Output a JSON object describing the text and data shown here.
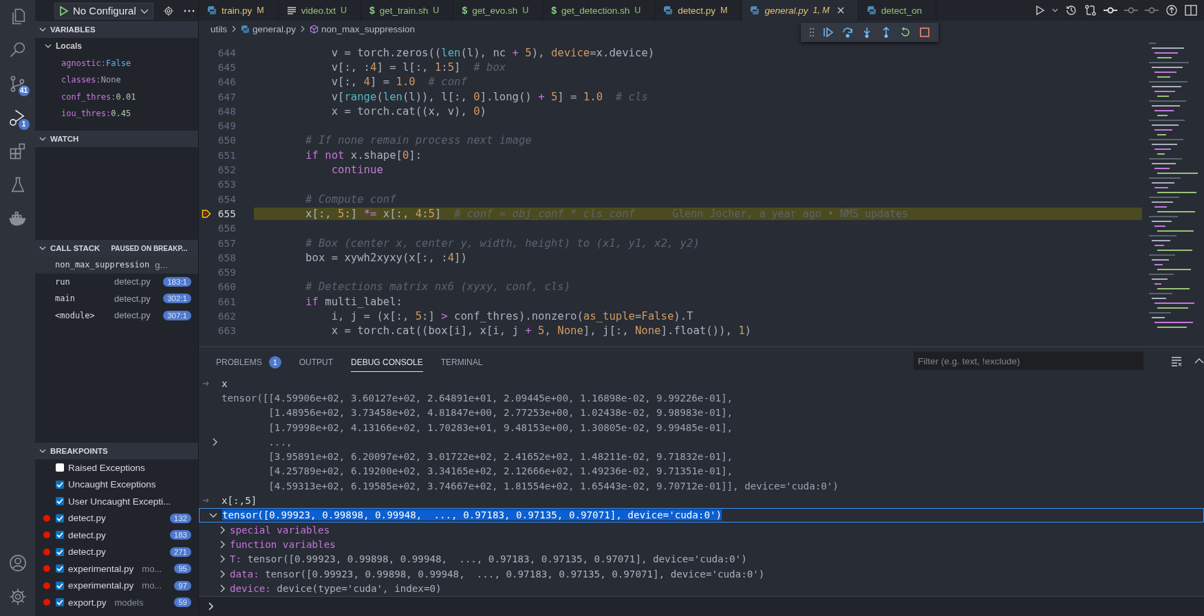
{
  "activity_bar": {
    "items": [
      {
        "kind": "files",
        "selected": false
      },
      {
        "kind": "search",
        "selected": false
      },
      {
        "kind": "scm",
        "selected": false,
        "badge": "41"
      },
      {
        "kind": "debug",
        "selected": true,
        "badge": "1"
      },
      {
        "kind": "extensions",
        "selected": false
      },
      {
        "kind": "testing",
        "selected": false
      },
      {
        "kind": "docker",
        "selected": false
      }
    ],
    "bottom_items": [
      {
        "kind": "account",
        "selected": false
      },
      {
        "kind": "settings",
        "selected": false
      }
    ]
  },
  "debug_bar": {
    "configuration": "No Configural"
  },
  "variables": {
    "title": "VARIABLES",
    "scope": "Locals",
    "items": [
      {
        "name": "agnostic:",
        "value": "False",
        "kind": "bool"
      },
      {
        "name": "classes:",
        "value": "None",
        "kind": "none"
      },
      {
        "name": "conf_thres:",
        "value": "0.01",
        "kind": "number"
      },
      {
        "name": "iou_thres:",
        "value": "0.45",
        "kind": "number"
      }
    ]
  },
  "watch": {
    "title": "WATCH"
  },
  "call_stack": {
    "title": "CALL STACK",
    "status": "PAUSED ON BREAKP...",
    "frames": [
      {
        "name": "non_max_suppression",
        "file": "g...",
        "selected": true
      },
      {
        "name": "run",
        "file": "detect.py",
        "line": "183:1",
        "selected": false
      },
      {
        "name": "main",
        "file": "detect.py",
        "line": "302:1",
        "selected": false
      },
      {
        "name": "<module>",
        "file": "detect.py",
        "line": "307:1",
        "selected": false
      }
    ]
  },
  "breakpoints": {
    "title": "BREAKPOINTS",
    "items": [
      {
        "kind": "exception",
        "label": "Raised Exceptions",
        "checked": false
      },
      {
        "kind": "exception",
        "label": "Uncaught Exceptions",
        "checked": true
      },
      {
        "kind": "exception",
        "label": "User Uncaught Excepti...",
        "checked": true
      },
      {
        "kind": "file",
        "label": "detect.py",
        "checked": true,
        "line": "132"
      },
      {
        "kind": "file",
        "label": "detect.py",
        "checked": true,
        "line": "183"
      },
      {
        "kind": "file",
        "label": "detect.py",
        "checked": true,
        "line": "271"
      },
      {
        "kind": "file",
        "label": "experimental.py",
        "path": "mo...",
        "checked": true,
        "line": "95"
      },
      {
        "kind": "file",
        "label": "experimental.py",
        "path": "mo...",
        "checked": true,
        "line": "97"
      },
      {
        "kind": "file",
        "label": "export.py",
        "path": "models",
        "checked": true,
        "line": "59"
      }
    ]
  },
  "tabs": [
    {
      "kind": "python",
      "label": "train.py",
      "status": "M",
      "color": "#e5c07b",
      "selected": false,
      "preview": false
    },
    {
      "kind": "text",
      "label": "video.txt",
      "status": "U",
      "color": "#98c379",
      "selected": false,
      "preview": false
    },
    {
      "kind": "shell",
      "glyph": "$",
      "label": "get_train.sh",
      "status": "U",
      "color": "#98c379",
      "selected": false,
      "preview": false
    },
    {
      "kind": "shell",
      "glyph": "$",
      "label": "get_evo.sh",
      "status": "U",
      "color": "#98c379",
      "selected": false,
      "preview": false
    },
    {
      "kind": "shell",
      "glyph": "$",
      "label": "get_detection.sh",
      "status": "U",
      "color": "#98c379",
      "selected": false,
      "preview": false
    },
    {
      "kind": "python",
      "label": "detect.py",
      "status": "M",
      "color": "#e5c07b",
      "selected": false,
      "preview": false
    },
    {
      "kind": "python",
      "label": "general.py",
      "status": "1, M",
      "color": "#e5c07b",
      "selected": true,
      "preview": true
    },
    {
      "kind": "python",
      "label": "detect_on",
      "color": "#98c379",
      "selected": false,
      "preview": false
    }
  ],
  "breadcrumbs": [
    {
      "kind": "folder",
      "label": "utils"
    },
    {
      "kind": "python",
      "label": "general.py"
    },
    {
      "kind": "symbol",
      "label": "non_max_suppression"
    }
  ],
  "editor": {
    "lines": [
      {
        "number": "644",
        "current": false,
        "tokens": [
          {
            "text": "            v = torch.zeros((",
            "kind": "plain"
          },
          {
            "text": "len",
            "kind": "builtin"
          },
          {
            "text": "(l), nc ",
            "kind": "plain"
          },
          {
            "text": "+ ",
            "kind": "op"
          },
          {
            "text": "5",
            "kind": "num"
          },
          {
            "text": "), ",
            "kind": "plain"
          },
          {
            "text": "device",
            "kind": "param"
          },
          {
            "text": "=x.device)",
            "kind": "plain"
          }
        ]
      },
      {
        "number": "645",
        "current": false,
        "tokens": [
          {
            "text": "            v[:, :",
            "kind": "plain"
          },
          {
            "text": "4",
            "kind": "num"
          },
          {
            "text": "] = l[:, ",
            "kind": "plain"
          },
          {
            "text": "1",
            "kind": "num"
          },
          {
            "text": ":",
            "kind": "plain"
          },
          {
            "text": "5",
            "kind": "num"
          },
          {
            "text": "]  ",
            "kind": "plain"
          },
          {
            "text": "# box",
            "kind": "comment"
          }
        ]
      },
      {
        "number": "646",
        "current": false,
        "tokens": [
          {
            "text": "            v[:, ",
            "kind": "plain"
          },
          {
            "text": "4",
            "kind": "num"
          },
          {
            "text": "] = ",
            "kind": "plain"
          },
          {
            "text": "1.0",
            "kind": "num"
          },
          {
            "text": "  # conf",
            "kind": "comment"
          }
        ]
      },
      {
        "number": "647",
        "current": false,
        "tokens": [
          {
            "text": "            v[",
            "kind": "plain"
          },
          {
            "text": "range",
            "kind": "builtin"
          },
          {
            "text": "(",
            "kind": "plain"
          },
          {
            "text": "len",
            "kind": "builtin"
          },
          {
            "text": "(l)), l[:, ",
            "kind": "plain"
          },
          {
            "text": "0",
            "kind": "num"
          },
          {
            "text": "].long() ",
            "kind": "plain"
          },
          {
            "text": "+ ",
            "kind": "op"
          },
          {
            "text": "5",
            "kind": "num"
          },
          {
            "text": "] = ",
            "kind": "plain"
          },
          {
            "text": "1.0",
            "kind": "num"
          },
          {
            "text": "  # cls",
            "kind": "comment"
          }
        ]
      },
      {
        "number": "648",
        "current": false,
        "tokens": [
          {
            "text": "            x = torch.cat((x, v), ",
            "kind": "plain"
          },
          {
            "text": "0",
            "kind": "num"
          },
          {
            "text": ")",
            "kind": "plain"
          }
        ]
      },
      {
        "number": "649",
        "current": false
      },
      {
        "number": "650",
        "current": false,
        "tokens": [
          {
            "text": "        # If none remain process next image",
            "kind": "comment"
          }
        ]
      },
      {
        "number": "651",
        "current": false,
        "tokens": [
          {
            "text": "        if ",
            "kind": "keyword"
          },
          {
            "text": "not",
            "kind": "keyword"
          },
          {
            "text": " x.shape[",
            "kind": "plain"
          },
          {
            "text": "0",
            "kind": "num"
          },
          {
            "text": "]:",
            "kind": "plain"
          }
        ]
      },
      {
        "number": "652",
        "current": false,
        "tokens": [
          {
            "text": "            continue",
            "kind": "keyword"
          }
        ]
      },
      {
        "number": "653",
        "current": false
      },
      {
        "number": "654",
        "current": false,
        "tokens": [
          {
            "text": "        # Compute conf",
            "kind": "comment"
          }
        ]
      },
      {
        "number": "655",
        "current": true,
        "blame": "Glenn Jocher, a year ago • NMS updates",
        "tokens": [
          {
            "text": "        x[:, ",
            "kind": "plain"
          },
          {
            "text": "5",
            "kind": "num"
          },
          {
            "text": ":] ",
            "kind": "plain"
          },
          {
            "text": "*=",
            "kind": "op"
          },
          {
            "text": " x[:, ",
            "kind": "plain"
          },
          {
            "text": "4",
            "kind": "num"
          },
          {
            "text": ":",
            "kind": "plain"
          },
          {
            "text": "5",
            "kind": "num"
          },
          {
            "text": "]  ",
            "kind": "plain"
          },
          {
            "text": "# conf = obj_conf * cls_conf",
            "kind": "comment"
          }
        ]
      },
      {
        "number": "656",
        "current": false
      },
      {
        "number": "657",
        "current": false,
        "tokens": [
          {
            "text": "        # Box (center x, center y, width, height) to (x1, y1, x2, y2)",
            "kind": "comment"
          }
        ]
      },
      {
        "number": "658",
        "current": false,
        "tokens": [
          {
            "text": "        box = xywh2xyxy(x[:, :",
            "kind": "plain"
          },
          {
            "text": "4",
            "kind": "num"
          },
          {
            "text": "])",
            "kind": "plain"
          }
        ]
      },
      {
        "number": "659",
        "current": false
      },
      {
        "number": "660",
        "current": false,
        "tokens": [
          {
            "text": "        # Detections matrix nx6 (xyxy, conf, cls)",
            "kind": "comment"
          }
        ]
      },
      {
        "number": "661",
        "current": false,
        "tokens": [
          {
            "text": "        if",
            "kind": "keyword"
          },
          {
            "text": " multi_label:",
            "kind": "plain"
          }
        ]
      },
      {
        "number": "662",
        "current": false,
        "tokens": [
          {
            "text": "            i, j = (x[:, ",
            "kind": "plain"
          },
          {
            "text": "5",
            "kind": "num"
          },
          {
            "text": ":] ",
            "kind": "plain"
          },
          {
            "text": ">",
            "kind": "op"
          },
          {
            "text": " conf_thres).nonzero(",
            "kind": "plain"
          },
          {
            "text": "as_tuple",
            "kind": "param"
          },
          {
            "text": "=",
            "kind": "plain"
          },
          {
            "text": "False",
            "kind": "num"
          },
          {
            "text": ").T",
            "kind": "plain"
          }
        ]
      },
      {
        "number": "663",
        "current": false,
        "tokens": [
          {
            "text": "            x = torch.cat((box[i], x[i, j ",
            "kind": "plain"
          },
          {
            "text": "+ ",
            "kind": "op"
          },
          {
            "text": "5",
            "kind": "num"
          },
          {
            "text": ", ",
            "kind": "plain"
          },
          {
            "text": "None",
            "kind": "num"
          },
          {
            "text": "], j[:, ",
            "kind": "plain"
          },
          {
            "text": "None",
            "kind": "num"
          },
          {
            "text": "].float()), ",
            "kind": "plain"
          },
          {
            "text": "1",
            "kind": "num"
          },
          {
            "text": ")",
            "kind": "plain"
          }
        ]
      }
    ]
  },
  "panel": {
    "tabs": [
      {
        "label": "PROBLEMS",
        "badge": "1",
        "selected": false
      },
      {
        "label": "OUTPUT",
        "selected": false
      },
      {
        "label": "DEBUG CONSOLE",
        "selected": true
      },
      {
        "label": "TERMINAL",
        "selected": false
      }
    ],
    "filter": {
      "placeholder": "Filter (e.g. text, !exclude)"
    },
    "console": [
      {
        "kind": "input",
        "text": "x"
      },
      {
        "kind": "output",
        "text": "tensor([[4.59906e+02, 3.60127e+02, 2.64891e+01, 2.09445e+00, 1.16898e-02, 9.99226e-01],"
      },
      {
        "kind": "output",
        "text": "        [1.48956e+02, 3.73458e+02, 4.81847e+00, 2.77253e+00, 1.02438e-02, 9.98983e-01],"
      },
      {
        "kind": "output",
        "text": "        [1.79998e+02, 4.13166e+02, 1.70283e+01, 9.48153e+00, 1.30805e-02, 9.99485e-01],"
      },
      {
        "kind": "group",
        "expanded": false,
        "text": "        ...,"
      },
      {
        "kind": "output",
        "text": "        [3.95891e+02, 6.20097e+02, 3.01722e+02, 2.41652e+02, 1.48211e-02, 9.71832e-01],"
      },
      {
        "kind": "output",
        "text": "        [4.25789e+02, 6.19200e+02, 3.34165e+02, 2.12666e+02, 1.49236e-02, 9.71351e-01],"
      },
      {
        "kind": "output",
        "text": "        [4.59313e+02, 6.19585e+02, 3.74667e+02, 1.81554e+02, 1.65443e-02, 9.70712e-01]], device='cuda:0')"
      },
      {
        "kind": "input",
        "text": "x[:,5]"
      },
      {
        "kind": "result",
        "expanded": true,
        "selected": true,
        "text": "tensor([0.99923, 0.99898, 0.99948,  ..., 0.97183, 0.97135, 0.97071], device='cuda:0')",
        "children": [
          {
            "name": "special variables",
            "expanded": false
          },
          {
            "name": "function variables",
            "expanded": false
          },
          {
            "name": "T:",
            "value": "tensor([0.99923, 0.99898, 0.99948,  ..., 0.97183, 0.97135, 0.97071], device='cuda:0')",
            "expanded": false
          },
          {
            "name": "data:",
            "value": "tensor([0.99923, 0.99898, 0.99948,  ..., 0.97183, 0.97135, 0.97071], device='cuda:0')",
            "expanded": false
          },
          {
            "name": "device:",
            "value": "device(type='cuda', index=0)",
            "expanded": false
          }
        ]
      }
    ]
  }
}
